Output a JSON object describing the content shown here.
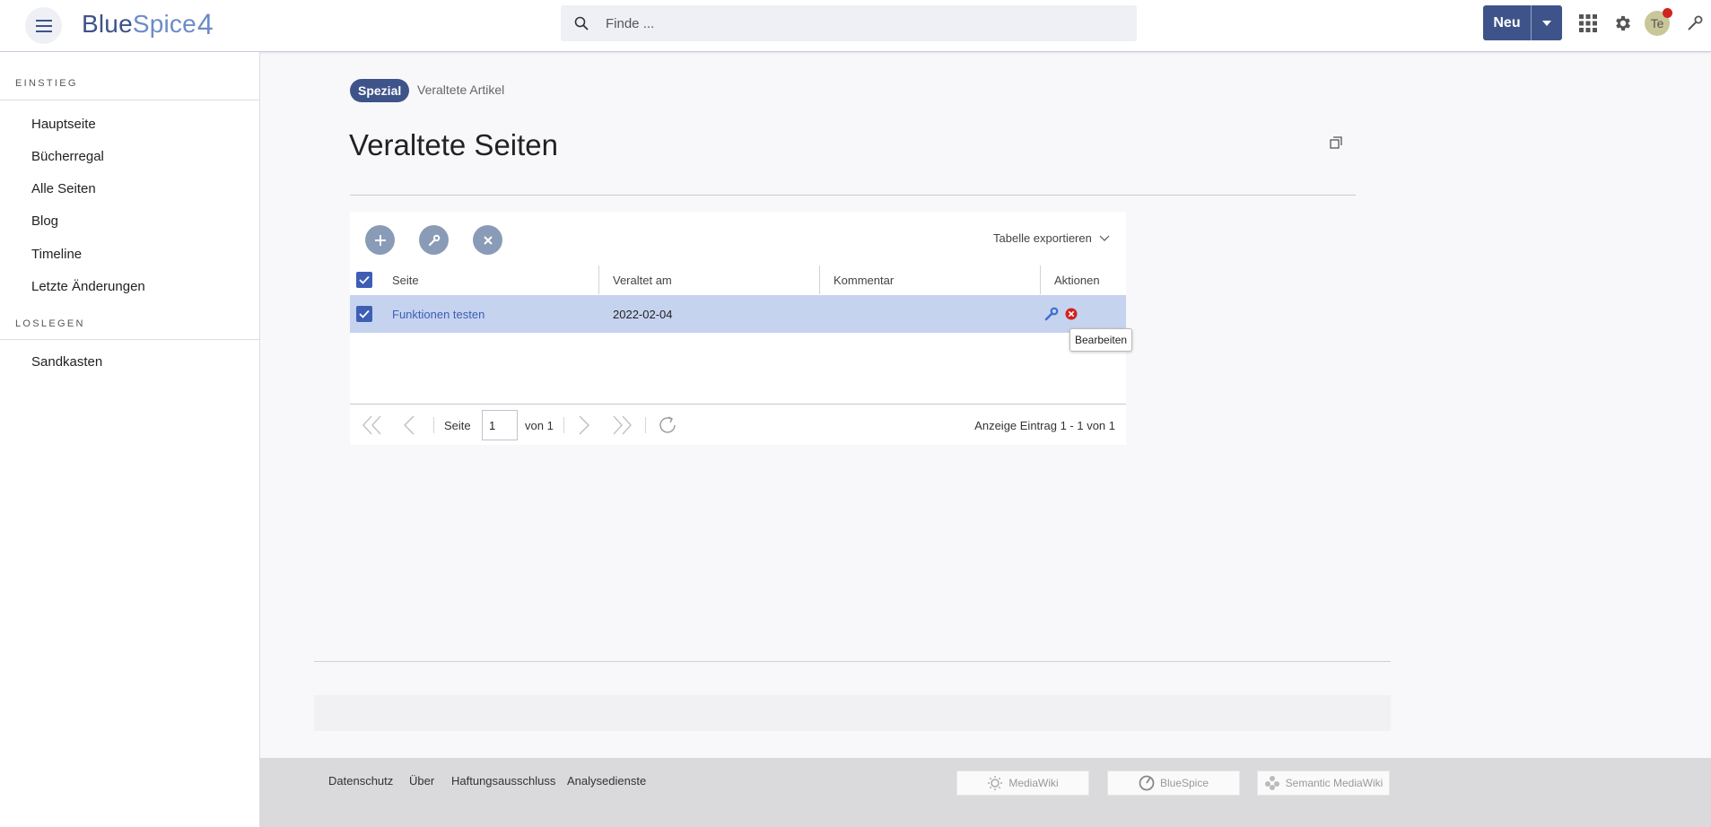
{
  "header": {
    "logo_blue": "Blue",
    "logo_spice": "Spice",
    "logo_num": "4",
    "search_placeholder": "Finde ...",
    "new_label": "Neu",
    "avatar_initials": "Te"
  },
  "sidebar": {
    "section1": "EINSTIEG",
    "items1": [
      "Hauptseite",
      "Bücherregal",
      "Alle Seiten",
      "Blog",
      "Timeline",
      "Letzte Änderungen"
    ],
    "section2": "LOSLEGEN",
    "items2": [
      "Sandkasten"
    ]
  },
  "breadcrumb": {
    "pill": "Spezial",
    "current": "Veraltete Artikel"
  },
  "page_title": "Veraltete Seiten",
  "grid": {
    "export_label": "Tabelle exportieren",
    "columns": [
      "Seite",
      "Veraltet am",
      "Kommentar",
      "Aktionen"
    ],
    "rows": [
      {
        "page": "Funktionen testen",
        "date": "2022-02-04",
        "comment": ""
      }
    ],
    "tooltip": "Bearbeiten",
    "pager": {
      "page_label": "Seite",
      "page_value": "1",
      "of_label": "von 1",
      "summary": "Anzeige Eintrag 1 - 1 von 1"
    }
  },
  "footer": {
    "links": [
      "Datenschutz",
      "Über",
      "Haftungsausschluss",
      "Analysedienste"
    ],
    "badges": [
      "MediaWiki",
      "BlueSpice",
      "Semantic MediaWiki"
    ]
  },
  "colors": {
    "primary": "#3e5389",
    "selected_row": "#c6d3ef",
    "checkbox": "#3e5eb5",
    "delete_red": "#d0231f"
  }
}
